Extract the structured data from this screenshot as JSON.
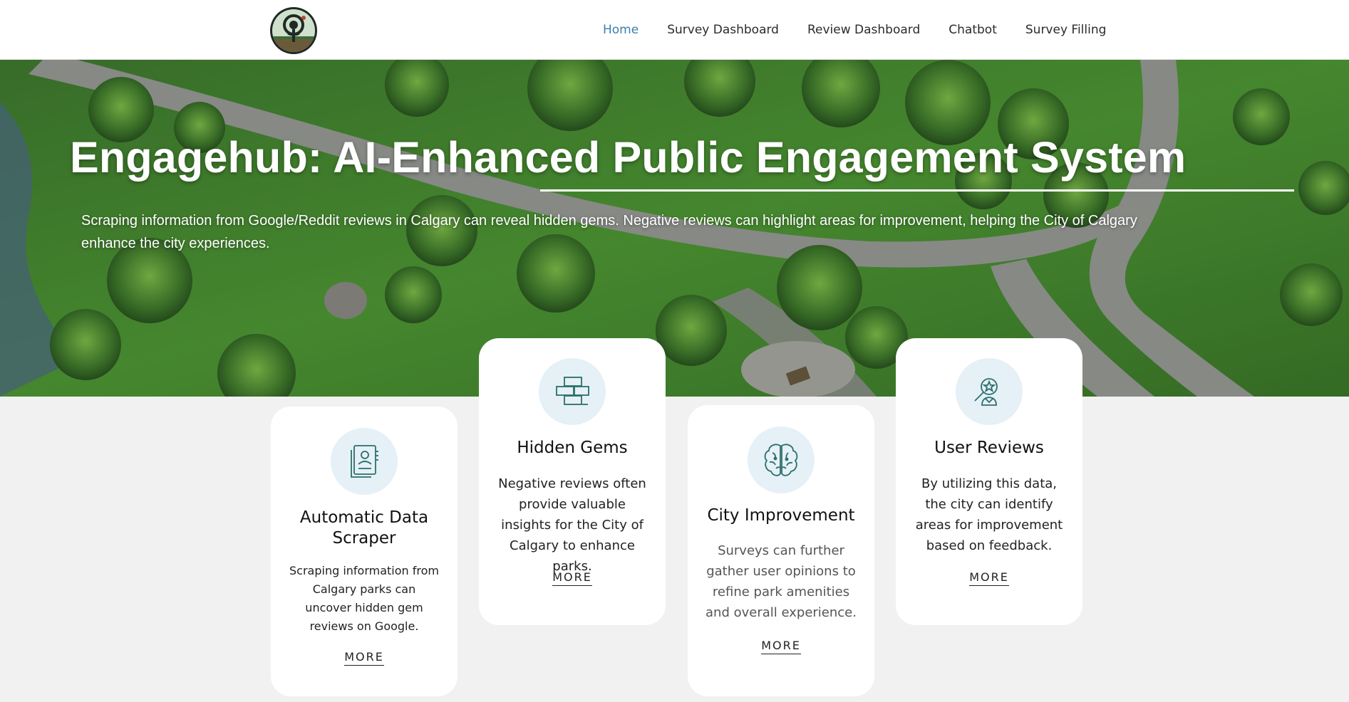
{
  "header": {
    "logo_alt": "Tree logo",
    "nav": [
      {
        "label": "Home",
        "active": true
      },
      {
        "label": "Survey Dashboard",
        "active": false
      },
      {
        "label": "Review Dashboard",
        "active": false
      },
      {
        "label": "Chatbot",
        "active": false
      },
      {
        "label": "Survey Filling",
        "active": false
      }
    ]
  },
  "hero": {
    "title": "Engagehub: AI-Enhanced Public Engagement System",
    "description": "Scraping information from Google/Reddit reviews in Calgary can reveal hidden gems. Negative reviews can highlight areas for improvement, helping the City of Calgary enhance the city experiences."
  },
  "cards": [
    {
      "icon": "profile-document-icon",
      "title": "Automatic Data Scraper",
      "text": "Scraping information from Calgary parks can uncover hidden gem reviews on Google.",
      "more": "MORE"
    },
    {
      "icon": "bricks-icon",
      "title": "Hidden Gems",
      "text": "Negative reviews often provide valuable insights for the City of Calgary to enhance parks.",
      "more": "MORE"
    },
    {
      "icon": "brain-icon",
      "title": "City Improvement",
      "text": "Surveys can further gather user opinions to refine park amenities and overall experience.",
      "more": "MORE"
    },
    {
      "icon": "user-search-icon",
      "title": "User Reviews",
      "text": "By utilizing this data, the city can identify areas for improvement based on feedback.",
      "more": "MORE"
    }
  ],
  "colors": {
    "accent_nav": "#3b7fb1",
    "icon_bg": "#e5f0f7",
    "icon_stroke": "#2c6f6b",
    "page_bg": "#f1f1f1"
  }
}
